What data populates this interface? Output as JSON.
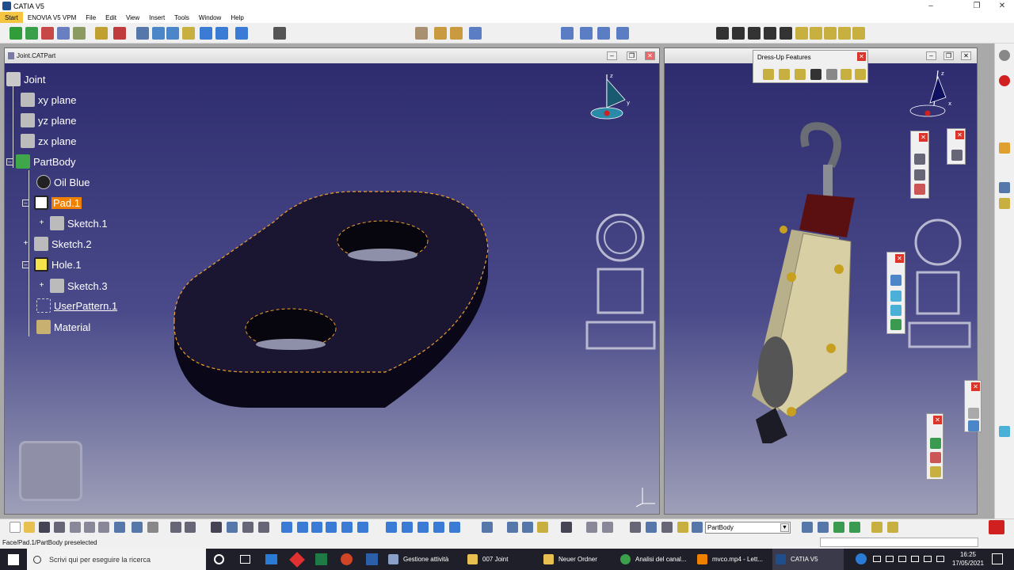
{
  "window": {
    "title": "CATIA V5",
    "minimize": "–",
    "restore": "❐",
    "close": "✕"
  },
  "menu": [
    "Start",
    "ENOVIA V5 VPM",
    "File",
    "Edit",
    "View",
    "Insert",
    "Tools",
    "Window",
    "Help"
  ],
  "left_viewer": {
    "title": "Joint.CATPart",
    "tree": {
      "root": "Joint",
      "items": [
        {
          "label": "xy plane"
        },
        {
          "label": "yz plane"
        },
        {
          "label": "zx plane"
        },
        {
          "label": "PartBody"
        },
        {
          "label": "Oil Blue"
        },
        {
          "label": "Pad.1"
        },
        {
          "label": "Sketch.1"
        },
        {
          "label": "Sketch.2"
        },
        {
          "label": "Hole.1"
        },
        {
          "label": "Sketch.3"
        },
        {
          "label": "UserPattern.1"
        },
        {
          "label": "Material"
        }
      ]
    }
  },
  "right_viewer": {
    "dressup_title": "Dress-Up Features"
  },
  "axis_labels": {
    "x": "x",
    "y": "y",
    "z": "z"
  },
  "bottom_toolbar": {
    "body_select": "PartBody"
  },
  "status": {
    "text": "Face/Pad.1/PartBody preselected"
  },
  "taskbar": {
    "search_placeholder": "Scrivi qui per eseguire la ricerca",
    "tasks": [
      {
        "label": "Gestione attività"
      },
      {
        "label": "007 Joint"
      },
      {
        "label": "Neuer Ordner"
      },
      {
        "label": "Analisi del canal..."
      },
      {
        "label": "mvco.mp4 - Lett..."
      },
      {
        "label": "CATIA V5"
      }
    ],
    "time": "16:25",
    "date": "17/05/2021"
  },
  "colors": {
    "highlight": "#f08000",
    "preselect_edge": "#f0a030",
    "part": "#16132a",
    "viewport_top": "#2e2c6e",
    "viewport_bottom": "#9e9fb8"
  }
}
